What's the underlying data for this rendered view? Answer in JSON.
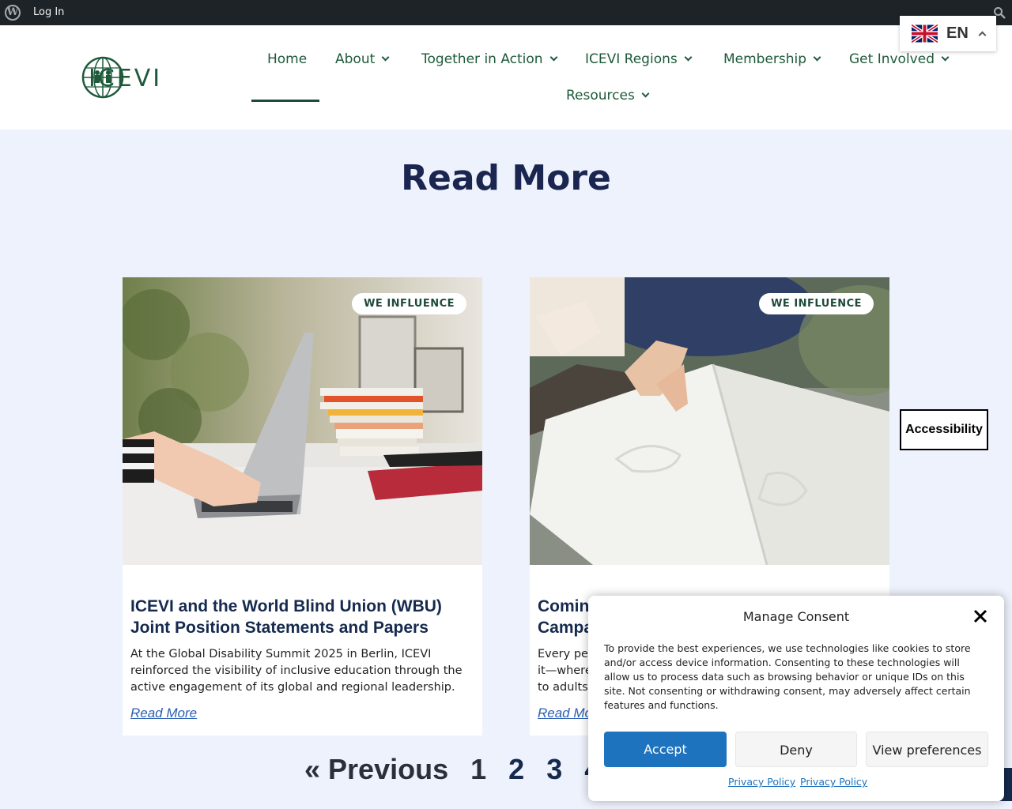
{
  "admin_bar": {
    "login_label": "Log In"
  },
  "site": {
    "logo_text": "ICEVI"
  },
  "nav": {
    "row1": [
      {
        "label": "Home"
      },
      {
        "label": "About"
      },
      {
        "label": "Together in Action"
      },
      {
        "label": "ICEVI Regions"
      },
      {
        "label": "Membership"
      },
      {
        "label": "Get Involved"
      }
    ],
    "row2": [
      {
        "label": "Resources"
      }
    ]
  },
  "language": {
    "code": "EN"
  },
  "page": {
    "heading": "Read More"
  },
  "cards": [
    {
      "badge": "WE INFLUENCE",
      "title": "ICEVI and the World Blind Union (WBU) Joint Position Statements and Papers",
      "excerpt": "At the Global Disability Summit 2025 in Berlin, ICEVI reinforced the visibility of inclusive education through the active engagement of its global and regional leadership.",
      "link": "Read More"
    },
    {
      "badge": "WE INFLUENCE",
      "title": "Comin",
      "title_line2": "Campa",
      "excerpt_lines": [
        "Every per",
        "it—where",
        "to adults"
      ],
      "link": "Read Mo"
    }
  ],
  "pagination": {
    "previous": "« Previous",
    "pages": [
      "1",
      "2",
      "3",
      "4"
    ]
  },
  "accessibility": {
    "label": "Accessibility"
  },
  "consent": {
    "title": "Manage Consent",
    "text": "To provide the best experiences, we use technologies like cookies to store and/or access device information. Consenting to these technologies will allow us to process data such as browsing behavior or unique IDs on this site. Not consenting or withdrawing consent, may adversely affect certain features and functions.",
    "accept": "Accept",
    "deny": "Deny",
    "preferences": "View preferences",
    "links": [
      "Privacy Policy",
      "Privacy Policy"
    ]
  },
  "colors": {
    "brand_green": "#1e5a3a",
    "heading_navy": "#1a2550",
    "accept_blue": "#1e73be"
  }
}
